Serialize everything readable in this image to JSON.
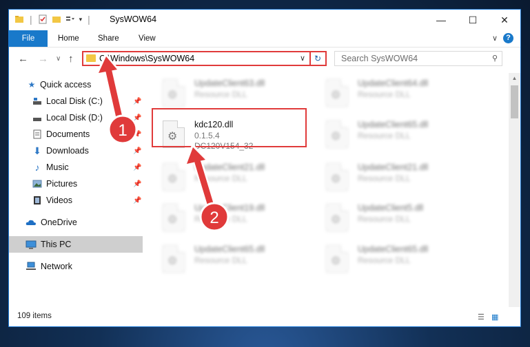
{
  "window": {
    "title": "SysWOW64",
    "controls": {
      "minimize": "—",
      "maximize": "☐",
      "close": "✕"
    }
  },
  "ribbon": {
    "tabs": [
      "File",
      "Home",
      "Share",
      "View"
    ],
    "expand_icon": "chevron-down-icon",
    "help_label": "?"
  },
  "nav": {
    "back": "←",
    "forward": "→",
    "recent": "∨",
    "up": "↑",
    "address": "C:\\Windows\\SysWOW64",
    "search_placeholder": "Search SysWOW64"
  },
  "sidebar": {
    "items": [
      {
        "label": "Quick access",
        "icon": "star-icon",
        "pinned": false
      },
      {
        "label": "Local Disk (C:)",
        "icon": "drive-icon",
        "pinned": true
      },
      {
        "label": "Local Disk (D:)",
        "icon": "drive-icon",
        "pinned": true
      },
      {
        "label": "Documents",
        "icon": "documents-icon",
        "pinned": true
      },
      {
        "label": "Downloads",
        "icon": "download-icon",
        "pinned": true
      },
      {
        "label": "Music",
        "icon": "music-icon",
        "pinned": true
      },
      {
        "label": "Pictures",
        "icon": "pictures-icon",
        "pinned": true
      },
      {
        "label": "Videos",
        "icon": "videos-icon",
        "pinned": true
      },
      {
        "label": "OneDrive",
        "icon": "cloud-icon",
        "pinned": false
      },
      {
        "label": "This PC",
        "icon": "computer-icon",
        "pinned": false,
        "selected": true
      },
      {
        "label": "Network",
        "icon": "network-icon",
        "pinned": false
      }
    ]
  },
  "files": [
    {
      "name": "UpdateClient63.dll",
      "line1": "Resource DLL",
      "line2": "",
      "focus": false
    },
    {
      "name": "UpdateClient64.dll",
      "line1": "Resource DLL",
      "line2": "",
      "focus": false
    },
    {
      "name": "kdc120.dll",
      "line1": "0.1.5.4",
      "line2": "DC120V154_32",
      "focus": true
    },
    {
      "name": "UpdateClient65.dll",
      "line1": "Resource DLL",
      "line2": "",
      "focus": false
    },
    {
      "name": "UpdateClient21.dll",
      "line1": "Resource DLL",
      "line2": "",
      "focus": false
    },
    {
      "name": "UpdateClient21.dll",
      "line1": "Resource DLL",
      "line2": "",
      "focus": false
    },
    {
      "name": "UpdateClient19.dll",
      "line1": "Resource DLL",
      "line2": "",
      "focus": false
    },
    {
      "name": "UpdateClient5.dll",
      "line1": "Resource DLL",
      "line2": "",
      "focus": false
    },
    {
      "name": "UpdateClient65.dll",
      "line1": "Resource DLL",
      "line2": "",
      "focus": false
    },
    {
      "name": "UpdateClient65.dll",
      "line1": "Resource DLL",
      "line2": "",
      "focus": false
    }
  ],
  "status": {
    "count": "109 items"
  },
  "annotations": {
    "badge1": "1",
    "badge2": "2",
    "color": "#e03a3a"
  }
}
